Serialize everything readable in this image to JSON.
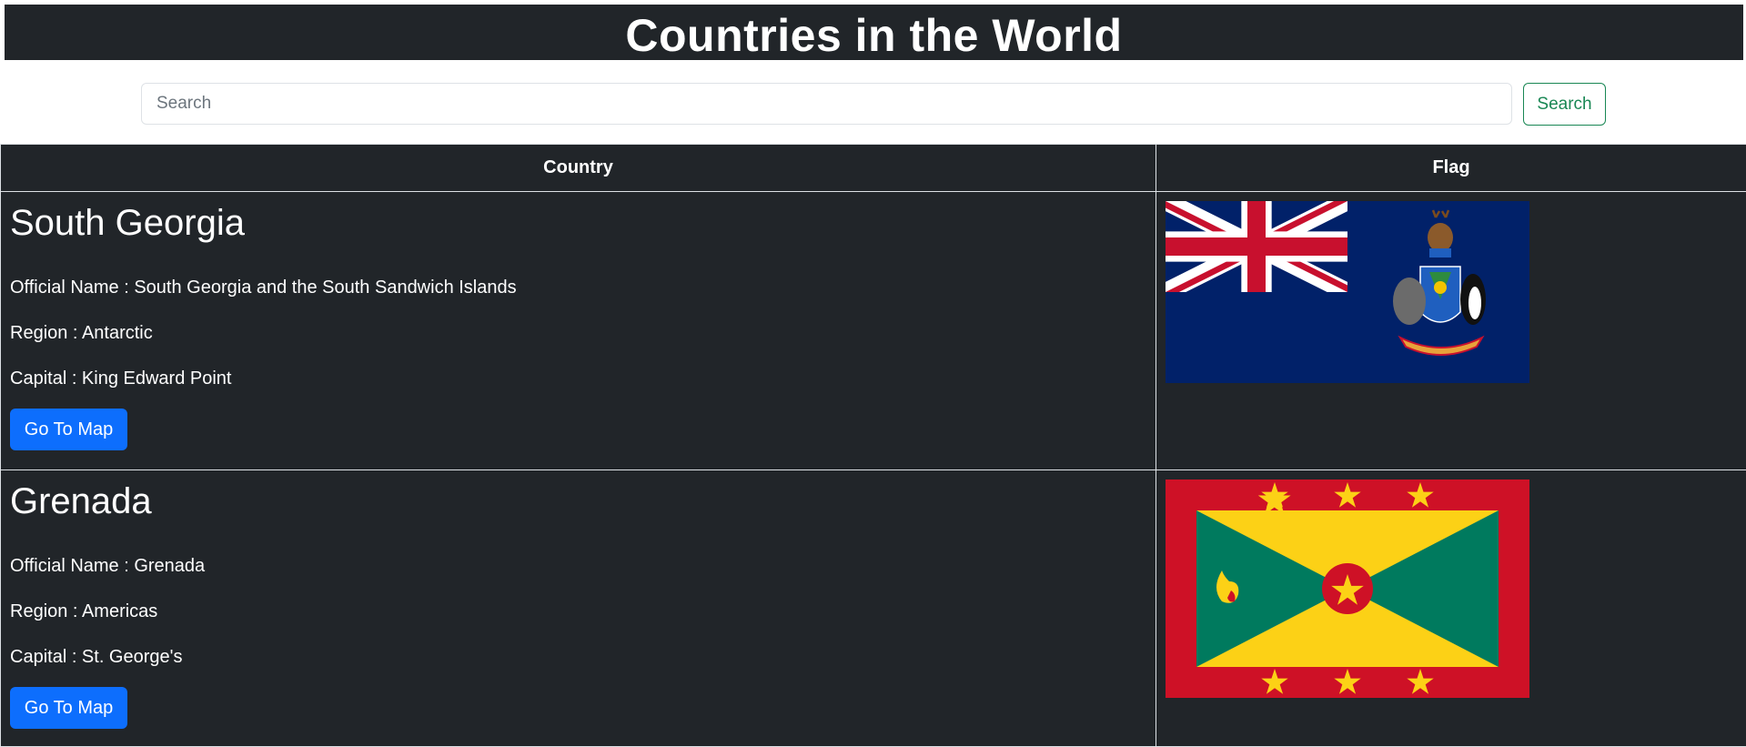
{
  "header": {
    "title": "Countries in the World"
  },
  "search": {
    "placeholder": "Search",
    "value": "",
    "button_label": "Search"
  },
  "table": {
    "columns": [
      "Country",
      "Flag"
    ],
    "rows": [
      {
        "name": "South Georgia",
        "official_name": "Official Name : South Georgia and the South Sandwich Islands",
        "region": "Region : Antarctic",
        "capital": "Capital : King Edward Point",
        "button_label": "Go To Map",
        "flag_icon": "south-georgia-flag-icon"
      },
      {
        "name": "Grenada",
        "official_name": "Official Name : Grenada",
        "region": "Region : Americas",
        "capital": "Capital : St. George's",
        "button_label": "Go To Map",
        "flag_icon": "grenada-flag-icon"
      }
    ]
  },
  "colors": {
    "header_bg": "#212529",
    "primary": "#0d6efd",
    "success": "#198754",
    "sg_blue": "#012169",
    "union_red": "#C8102E",
    "grenada_red": "#CE1126",
    "grenada_yellow": "#FCD116",
    "grenada_green": "#007A5E"
  }
}
